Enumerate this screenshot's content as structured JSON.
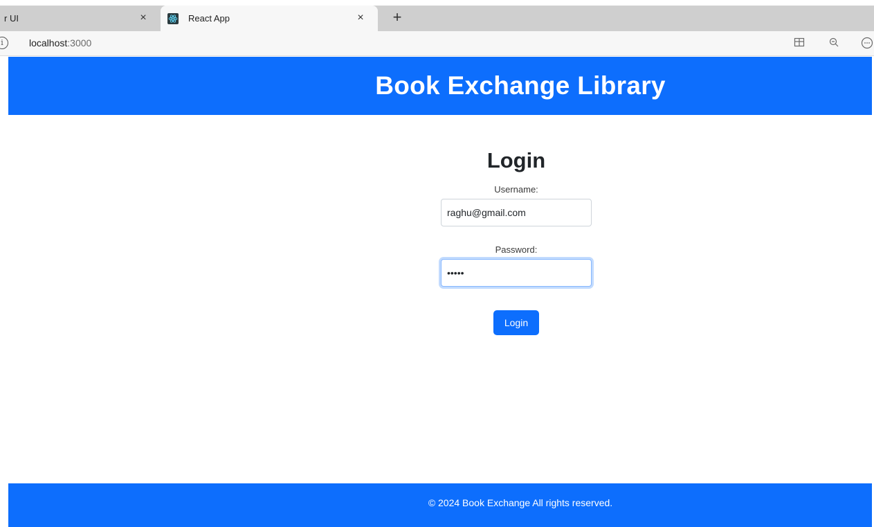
{
  "browser": {
    "tabs": [
      {
        "title": "r UI",
        "active": false
      },
      {
        "title": "React App",
        "active": true
      }
    ],
    "close_glyph": "×",
    "new_tab_glyph": "+",
    "url_host": "localhost",
    "url_port": ":3000",
    "site_info_glyph": "i",
    "icons": [
      "info-icon",
      "react-favicon-icon",
      "close-icon",
      "new-tab-icon",
      "split-screen-icon",
      "zoom-out-icon",
      "more-options-icon"
    ]
  },
  "header": {
    "title": "Book Exchange Library"
  },
  "login": {
    "title": "Login",
    "username_label": "Username:",
    "username_value": "raghu@gmail.com",
    "password_label": "Password:",
    "password_value": "abcde",
    "button_label": "Login"
  },
  "footer": {
    "text": "© 2024 Book Exchange All rights reserved."
  },
  "colors": {
    "primary": "#0d6efd",
    "focus_ring": "#86b7fe",
    "tabstrip": "#cfcfcf"
  }
}
